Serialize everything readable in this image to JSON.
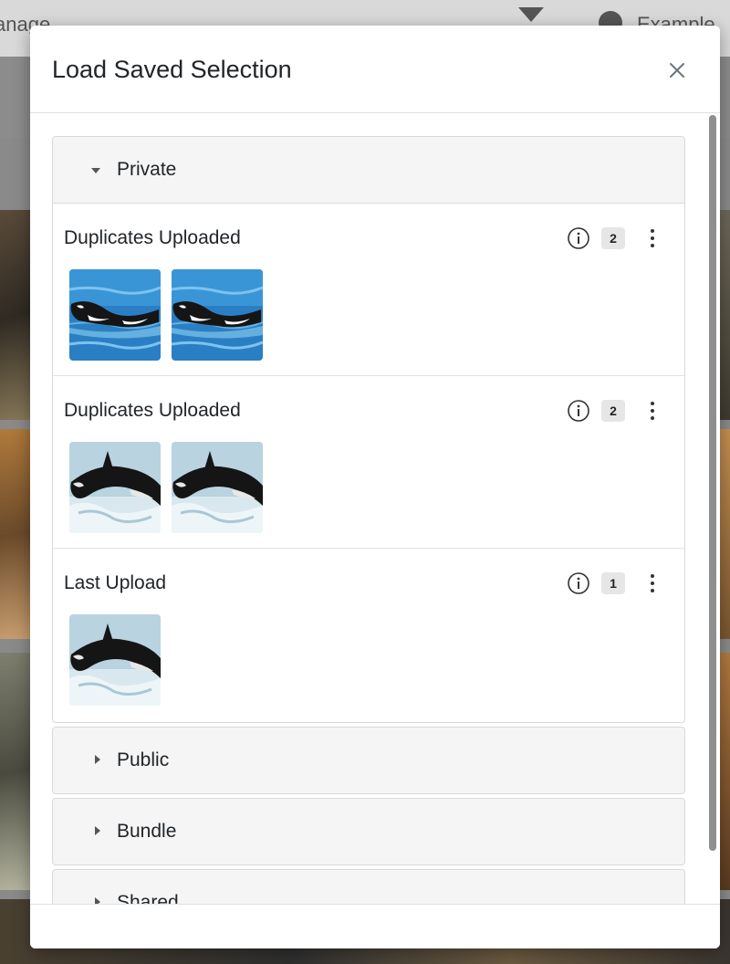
{
  "background": {
    "top_left_text": "anage",
    "top_right_text": "Example"
  },
  "modal": {
    "title": "Load Saved Selection",
    "close_glyph": "×",
    "groups": [
      {
        "label": "Private",
        "expanded": true,
        "items": [
          {
            "name": "Duplicates Uploaded",
            "count": "2",
            "thumbnails": [
              "orca-swimming",
              "orca-swimming"
            ]
          },
          {
            "name": "Duplicates Uploaded",
            "count": "2",
            "thumbnails": [
              "orca-jumping",
              "orca-jumping"
            ]
          },
          {
            "name": "Last Upload",
            "count": "1",
            "thumbnails": [
              "orca-jumping"
            ]
          }
        ]
      },
      {
        "label": "Public",
        "expanded": false
      },
      {
        "label": "Bundle",
        "expanded": false
      },
      {
        "label": "Shared",
        "expanded": false
      }
    ]
  },
  "icons": {
    "close": "close-icon",
    "info": "info-circle-icon",
    "more": "kebab-menu-icon",
    "expanded": "caret-down-icon",
    "collapsed": "caret-right-icon"
  },
  "colors": {
    "group_header_bg": "#f5f5f5",
    "badge_bg": "#e6e6e6",
    "ocean_blue": "#2a7fc4"
  }
}
